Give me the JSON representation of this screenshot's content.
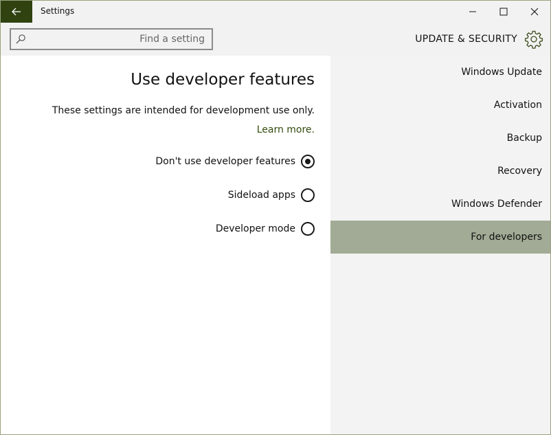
{
  "window": {
    "title": "Settings"
  },
  "search": {
    "placeholder": "Find a setting",
    "value": ""
  },
  "section": {
    "title": "UPDATE & SECURITY"
  },
  "main": {
    "title": "Use developer features",
    "description": "These settings are intended for development use only.",
    "learn_more": "Learn more.",
    "options": [
      {
        "label": "Don't use developer features",
        "selected": true
      },
      {
        "label": "Sideload apps",
        "selected": false
      },
      {
        "label": "Developer mode",
        "selected": false
      }
    ]
  },
  "nav": {
    "items": [
      {
        "label": "Windows Update",
        "selected": false
      },
      {
        "label": "Activation",
        "selected": false
      },
      {
        "label": "Backup",
        "selected": false
      },
      {
        "label": "Recovery",
        "selected": false
      },
      {
        "label": "Windows Defender",
        "selected": false
      },
      {
        "label": "For developers",
        "selected": true
      }
    ]
  },
  "colors": {
    "accent": "#2f4210",
    "selected_nav": "#a2ab95",
    "link": "#334b0e"
  },
  "icons": {
    "back": "back-arrow-icon",
    "search": "search-icon",
    "section": "gear-icon",
    "minimize": "minimize-icon",
    "maximize": "maximize-icon",
    "close": "close-icon"
  }
}
